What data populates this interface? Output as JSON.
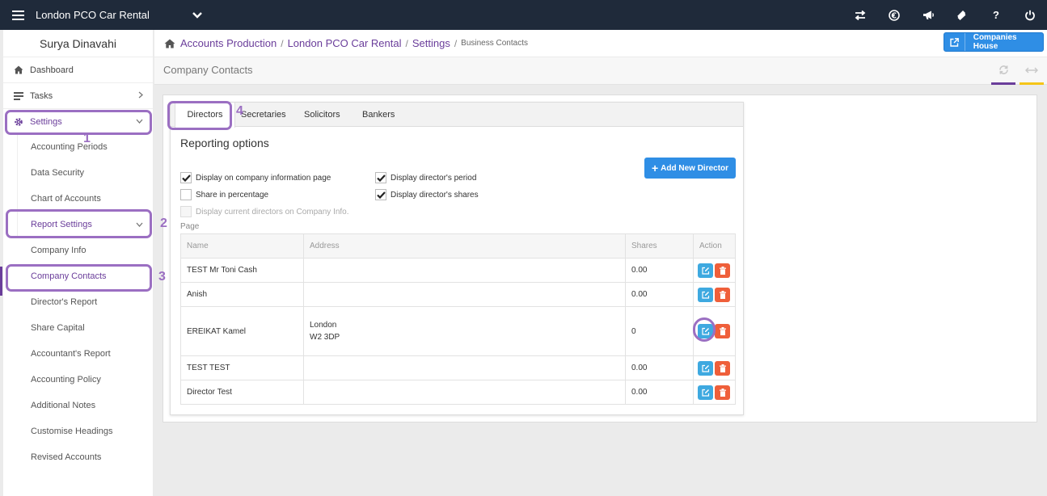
{
  "topbar": {
    "app_title": "London PCO Car Rental",
    "help_label": "?"
  },
  "sidebar": {
    "user_name": "Surya Dinavahi",
    "items": [
      {
        "label": "Dashboard"
      },
      {
        "label": "Tasks"
      },
      {
        "label": "Settings"
      }
    ],
    "settings_sub": [
      {
        "label": "Accounting Periods"
      },
      {
        "label": "Data Security"
      },
      {
        "label": "Chart of Accounts"
      },
      {
        "label": "Report Settings"
      }
    ],
    "report_sub": [
      {
        "label": "Company Info"
      },
      {
        "label": "Company Contacts"
      },
      {
        "label": "Director's Report"
      },
      {
        "label": "Share Capital"
      },
      {
        "label": "Accountant's Report"
      },
      {
        "label": "Accounting Policy"
      },
      {
        "label": "Additional Notes"
      },
      {
        "label": "Customise Headings"
      },
      {
        "label": "Revised Accounts"
      }
    ]
  },
  "callouts": [
    "1",
    "2",
    "3",
    "4"
  ],
  "breadcrumb": {
    "items": [
      "Accounts Production",
      "London PCO Car Rental",
      "Settings"
    ],
    "current": "Business Contacts"
  },
  "companies_house_label": "Companies House",
  "page_title": "Company Contacts",
  "tabs": [
    "Directors",
    "Secretaries",
    "Solicitors",
    "Bankers"
  ],
  "reporting": {
    "title": "Reporting options",
    "options": [
      {
        "label": "Display on company information page",
        "checked": true
      },
      {
        "label": "Share in percentage",
        "checked": false
      },
      {
        "label": "Display current directors on Company Info.",
        "checked": false,
        "disabled": true
      },
      {
        "label": "Display director's period",
        "checked": true
      },
      {
        "label": "Display director's shares",
        "checked": true
      }
    ],
    "wrap_text": "Page",
    "add_button": "Add New Director"
  },
  "table": {
    "columns": [
      "Name",
      "Address",
      "Shares",
      "Action"
    ],
    "rows": [
      {
        "name": "TEST Mr Toni Cash",
        "address1": "",
        "address2": "",
        "shares": "0.00"
      },
      {
        "name": "Anish",
        "address1": "",
        "address2": "",
        "shares": "0.00"
      },
      {
        "name": "EREIKAT Kamel",
        "address1": "London",
        "address2": "W2 3DP",
        "shares": "0"
      },
      {
        "name": "TEST TEST",
        "address1": "",
        "address2": "",
        "shares": "0.00"
      },
      {
        "name": "Director Test",
        "address1": "",
        "address2": "",
        "shares": "0.00"
      }
    ]
  },
  "colors": {
    "topbar": "#1f2a3a",
    "accent_purple": "#6a3d9a",
    "callout": "#9b6fc2",
    "primary_blue": "#2f8ee5",
    "edit_blue": "#3ea9e0",
    "delete_red": "#ef5f3a",
    "accent_yellow": "#f5c518"
  }
}
